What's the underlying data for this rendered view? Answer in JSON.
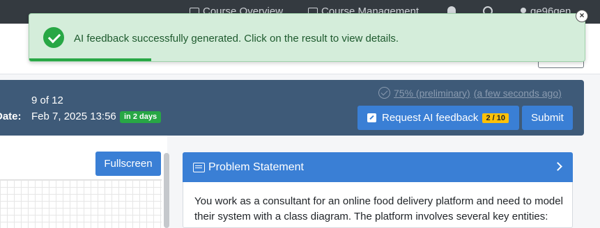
{
  "nav": {
    "course_overview": "Course Overview",
    "course_management": "Course Management",
    "user": "ge96gen"
  },
  "exercise": {
    "count": "9 of 12",
    "due_label": "Date:",
    "due_date": "Feb 7, 2025 13:56",
    "due_badge": "in 2 days",
    "score": "75% (preliminary)",
    "score_time": "(a few seconds ago)",
    "request_ai_label": "Request AI feedback",
    "ai_quota": "2 / 10",
    "submit_label": "Submit"
  },
  "editor": {
    "fullscreen_label": "Fullscreen"
  },
  "problem_statement": {
    "title": "Problem Statement",
    "text": "You work as a consultant for an online food delivery platform and need to model their system with a class diagram. The platform involves several key entities:"
  },
  "toast": {
    "message": "AI feedback successfully generated. Click on the result to view details.",
    "progress": 0.22
  },
  "colors": {
    "primary": "#3a7fd5",
    "header": "#3e5a78",
    "success": "#28a745",
    "warning": "#ffc107"
  }
}
